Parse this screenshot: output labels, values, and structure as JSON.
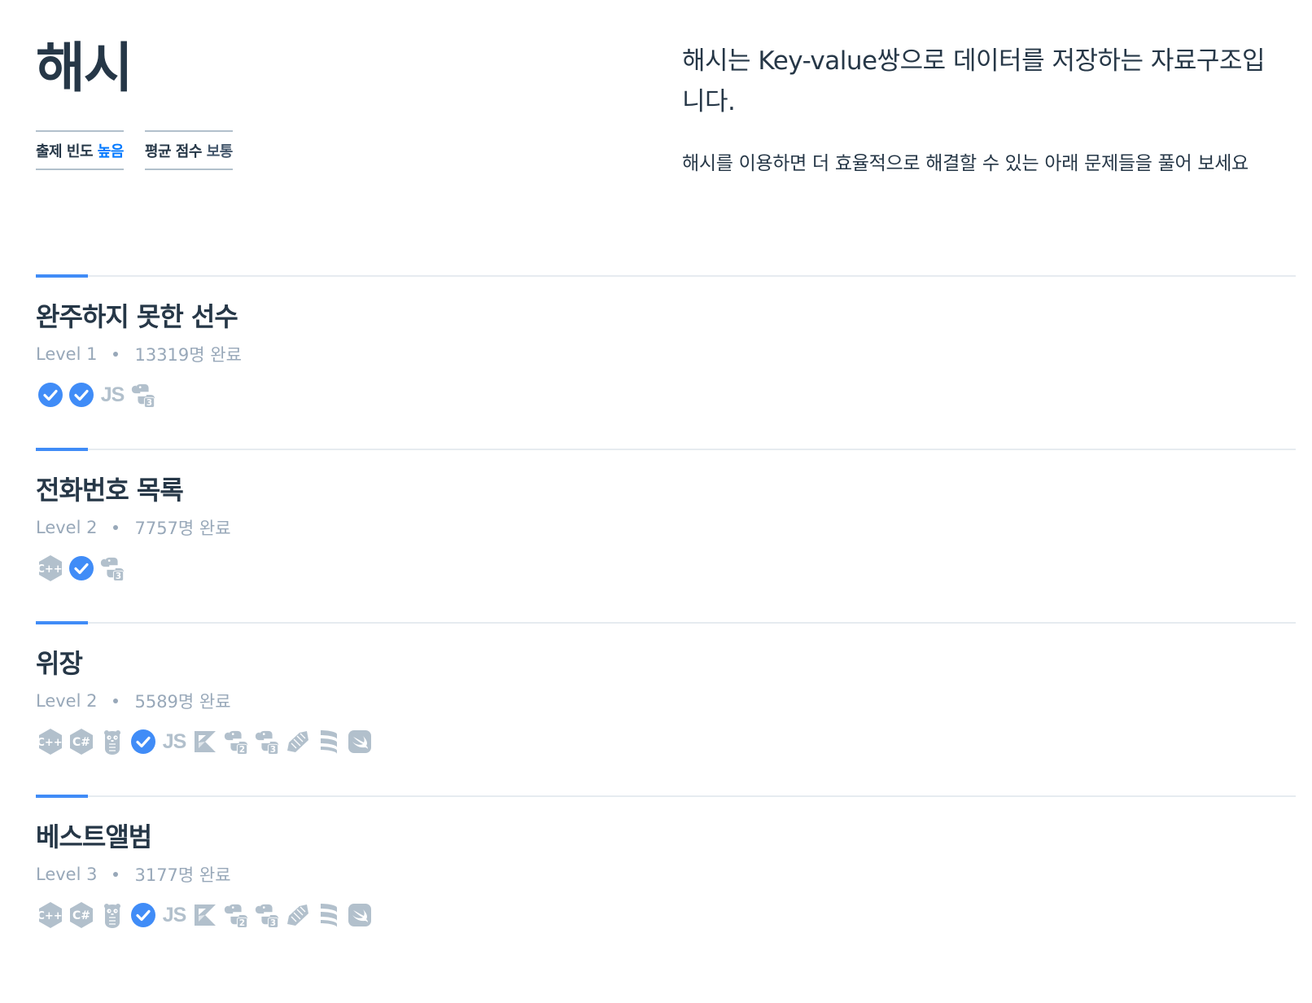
{
  "page": {
    "title": "해시",
    "stats": [
      {
        "label": "출제 빈도",
        "value": "높음"
      },
      {
        "label": "평균 점수",
        "value": "보통"
      }
    ],
    "description_lead": "해시는 Key-value쌍으로 데이터를 저장하는 자료구조입니다.",
    "description_sub": "해시를 이용하면 더 효율적으로 해결할 수 있는 아래 문제들을 풀어 보세요"
  },
  "problems": [
    {
      "title": "완주하지 못한 선수",
      "level": "Level 1",
      "completed": "13319명 완료",
      "languages": [
        "check-icon",
        "check-icon",
        "javascript-icon",
        "python3-icon"
      ]
    },
    {
      "title": "전화번호 목록",
      "level": "Level 2",
      "completed": "7757명 완료",
      "languages": [
        "cpp-icon",
        "check-icon",
        "python3-icon"
      ]
    },
    {
      "title": "위장",
      "level": "Level 2",
      "completed": "5589명 완료",
      "languages": [
        "cpp-icon",
        "csharp-icon",
        "go-icon",
        "check-icon",
        "javascript-icon",
        "kotlin-icon",
        "python2-icon",
        "python3-icon",
        "ruby-icon",
        "scala-icon",
        "swift-icon"
      ]
    },
    {
      "title": "베스트앨범",
      "level": "Level 3",
      "completed": "3177명 완료",
      "languages": [
        "cpp-icon",
        "csharp-icon",
        "go-icon",
        "check-icon",
        "javascript-icon",
        "kotlin-icon",
        "python2-icon",
        "python3-icon",
        "ruby-icon",
        "scala-icon",
        "swift-icon"
      ]
    }
  ],
  "colors": {
    "accent": "#408cf7",
    "check": "#408cf7",
    "icon_muted": "#b2c0cc",
    "meta_text": "#98a8b9",
    "heading": "#263747",
    "high": "#0078ff"
  }
}
